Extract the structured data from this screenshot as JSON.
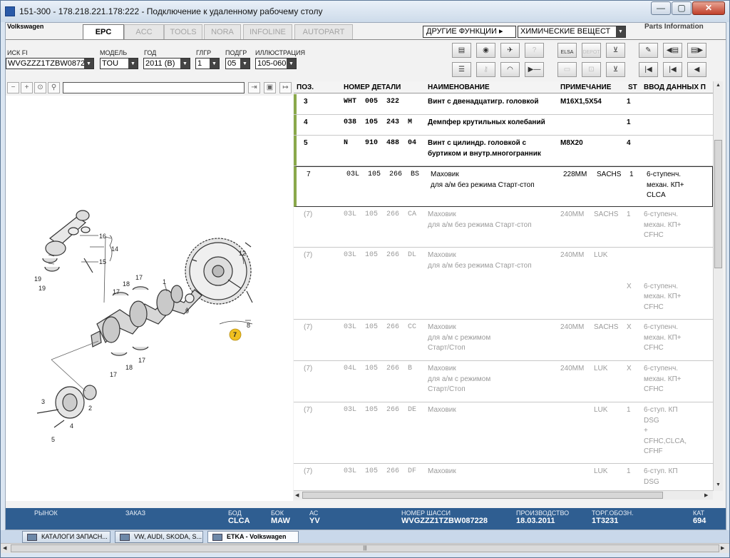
{
  "window": {
    "title": "151-300 - 178.218.221.178:222 - Подключение к удаленному рабочему столу",
    "minimize": "—",
    "maximize": "▢",
    "close": "✕"
  },
  "app": {
    "brand": "Volkswagen",
    "tabs": [
      {
        "label": "EPC",
        "active": true
      },
      {
        "label": "ACC",
        "active": false
      },
      {
        "label": "TOOLS",
        "active": false
      },
      {
        "label": "NORA",
        "active": false
      },
      {
        "label": "INFOLINE",
        "active": false
      },
      {
        "label": "AUTOPART",
        "active": false
      }
    ],
    "other_functions": "ДРУГИЕ ФУНКЦИИ ▸",
    "chemicals": "ХИМИЧЕСКИЕ ВЕЩЕСТ",
    "parts_info": "Parts Information"
  },
  "filters": {
    "vin": {
      "label": "ИСК FI",
      "value": "WVGZZZ1TZBW08722"
    },
    "model": {
      "label": "МОДЕЛЬ",
      "value": "TOU"
    },
    "year": {
      "label": "ГОД",
      "value": "2011 (B)"
    },
    "group": {
      "label": "ГЛГР",
      "value": "1"
    },
    "subgroup": {
      "label": "ПОДГР",
      "value": "05"
    },
    "illustration": {
      "label": "ИЛЛЮСТРАЦИЯ",
      "value": "105-060"
    }
  },
  "toolbar_icons": [
    "print-icon",
    "cd-icon",
    "car-repair-icon",
    "help-icon",
    "elsa-icon",
    "depot-icon",
    "cart-icon",
    "pin-icon",
    "prev-page-icon",
    "next-page-icon",
    "list-icon",
    "key-icon",
    "gauge-icon",
    "next-step-icon",
    "computer-icon",
    "car-icon",
    "cart-add-icon",
    "first-icon",
    "back-icon",
    "previous-icon"
  ],
  "toolbar_texts": {
    "elsa": "ELSA",
    "depot": "DEPOT"
  },
  "table": {
    "headers": {
      "pos": "ПОЗ.",
      "number": "НОМЕР ДЕТАЛИ",
      "name": "НАИМЕНОВАНИЕ",
      "note": "ПРИМЕЧАНИЕ",
      "st": "ST",
      "input": "ВВОД ДАННЫХ П"
    },
    "rows": [
      {
        "pos": "3",
        "number": "WHT  005  322",
        "name": "Винт с двенадцатигр. головкой",
        "note": "M16X1,5X54",
        "note2": "",
        "st": "1",
        "input": "",
        "state": "act"
      },
      {
        "pos": "4",
        "number": "038  105  243  M",
        "name": "Демпфер крутильных колебаний",
        "note": "",
        "note2": "",
        "st": "1",
        "input": "",
        "state": "act"
      },
      {
        "pos": "5",
        "number": "N    910  488  04",
        "name": "Винт с цилиндр. головкой с\nбуртиком и внутр.многогранник",
        "note": "M8X20",
        "note2": "",
        "st": "4",
        "input": "",
        "state": "act"
      },
      {
        "pos": "7",
        "number": "03L  105  266  BS",
        "name": "Маховик\nдля а/м без режима Старт-стоп",
        "note": "228MM",
        "note2": "SACHS",
        "st": "1",
        "input": "6-ступенч.\nмехан. КП+\nCLCA",
        "state": "sel"
      },
      {
        "pos": "(7)",
        "number": "03L  105  266  CA",
        "name": "Маховик\nдля а/м без режима Старт-стоп",
        "note": "240MM",
        "note2": "SACHS",
        "st": "1",
        "input": "6-ступенч.\nмехан. КП+\nCFHC",
        "state": "dim"
      },
      {
        "pos": "(7)",
        "number": "03L  105  266  DL",
        "name": "Маховик\nдля а/м без режима Старт-стоп",
        "note": "240MM",
        "note2": "LUK",
        "st": "\n\n\nX",
        "input": "\n\n\n6-ступенч.\nмехан. КП+\nCFHC",
        "state": "dim"
      },
      {
        "pos": "(7)",
        "number": "03L  105  266  CC",
        "name": "Маховик\nдля а/м с режимом\nСтарт/Стоп",
        "note": "240MM",
        "note2": "SACHS",
        "st": "X",
        "input": "6-ступенч.\nмехан. КП+\nCFHC",
        "state": "dim"
      },
      {
        "pos": "(7)",
        "number": "04L  105  266  B",
        "name": "Маховик\nдля а/м с режимом\nСтарт/Стоп",
        "note": "240MM",
        "note2": "LUK",
        "st": "X",
        "input": "6-ступенч.\nмехан. КП+\nCFHC",
        "state": "dim"
      },
      {
        "pos": "(7)",
        "number": "03L  105  266  DE",
        "name": "Маховик",
        "note": "",
        "note2": "LUK",
        "st": "1",
        "input": "6-ступ. КП\nDSG\n+\nCFHC,CLCA,\nCFHF",
        "state": "dim"
      },
      {
        "pos": "(7)",
        "number": "03L  105  266  DF",
        "name": "Маховик",
        "note": "",
        "note2": "LUK",
        "st": "1",
        "input": "6-ступ. КП\nDSG",
        "state": "dim"
      }
    ]
  },
  "illustration": {
    "callouts": [
      "16",
      "14",
      "15",
      "19",
      "19",
      "18",
      "17",
      "17",
      "1",
      "9",
      "12",
      "8",
      "7",
      "3",
      "2",
      "4",
      "5",
      "17",
      "18",
      "17"
    ]
  },
  "statusbar": {
    "market": {
      "label": "РЫНОК",
      "value": ""
    },
    "order": {
      "label": "ЗАКАЗ",
      "value": ""
    },
    "bod": {
      "label": "БОД",
      "value": "CLCA"
    },
    "bok": {
      "label": "БОК",
      "value": "MAW"
    },
    "ac": {
      "label": "АС",
      "value": "YV"
    },
    "chassis": {
      "label": "НОМЕР ШАССИ",
      "value": "WVGZZZ1TZBW087228"
    },
    "production": {
      "label": "ПРОИЗВОДСТВО",
      "value": "18.03.2011"
    },
    "trade": {
      "label": "ТОРГ.ОБОЗН.",
      "value": "1T3231"
    },
    "cat": {
      "label": "КАТ",
      "value": "694"
    }
  },
  "taskbar": [
    {
      "label": "КАТАЛОГИ ЗАПАСН...",
      "active": false
    },
    {
      "label": "VW, AUDI, SKODA, S...",
      "active": false
    },
    {
      "label": "ETKA - Volkswagen",
      "active": true
    }
  ],
  "grip": "|||"
}
